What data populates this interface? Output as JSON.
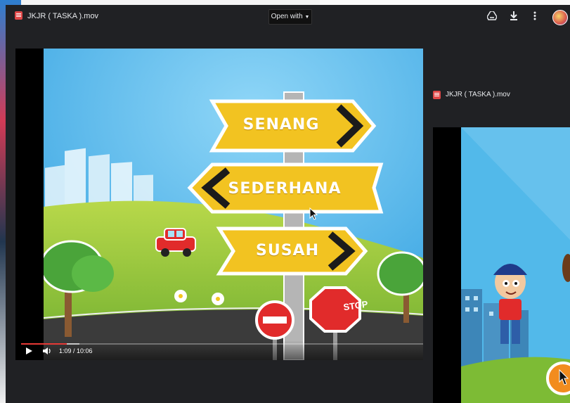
{
  "main_window": {
    "title": "JKJR ( TASKA ).mov",
    "open_with_label": "Open with",
    "icons": [
      "drive-add-icon",
      "download-icon",
      "more-vert-icon"
    ]
  },
  "video": {
    "signs": [
      "SENANG",
      "SEDERHANA",
      "SUSAH"
    ],
    "stop_sign": "STOP",
    "time_display": "1:09 / 10:06",
    "progress_fraction": 0.114
  },
  "second_window": {
    "title": "JKJR ( TASKA ).mov"
  },
  "colors": {
    "accent_red": "#e53935",
    "sign_yellow": "#f2c321",
    "sky": "#45b3e8"
  }
}
